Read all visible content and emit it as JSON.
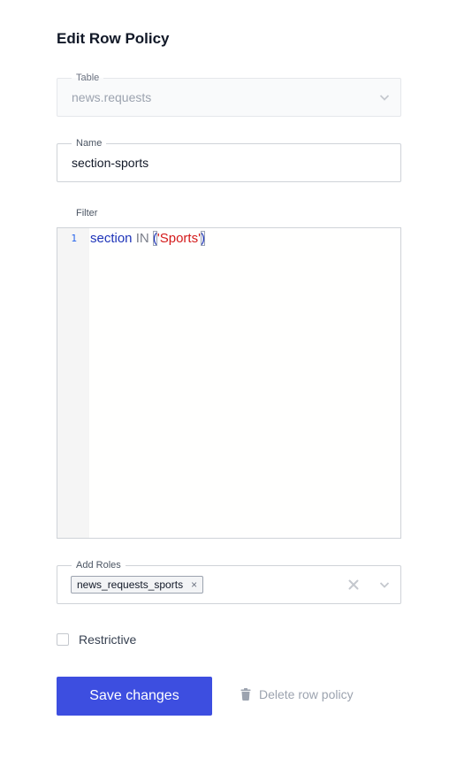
{
  "page": {
    "title": "Edit Row Policy"
  },
  "table_field": {
    "label": "Table",
    "value": "news.requests",
    "disabled": true,
    "icon": "chevron-down-icon"
  },
  "name_field": {
    "label": "Name",
    "value": "section-sports"
  },
  "filter": {
    "label": "Filter",
    "line_number": "1",
    "tokens": {
      "identifier": "section",
      "operator": "IN",
      "open_paren": "(",
      "string": "'Sports'",
      "close_paren": ")"
    }
  },
  "roles_field": {
    "label": "Add Roles",
    "selected": [
      "news_requests_sports"
    ],
    "remove_glyph": "×",
    "icons": [
      "clear-icon",
      "chevron-down-icon"
    ]
  },
  "restrictive": {
    "label": "Restrictive",
    "checked": false
  },
  "actions": {
    "save_label": "Save changes",
    "delete_label": "Delete row policy",
    "delete_icon": "trash-icon"
  },
  "colors": {
    "primary": "#3d4ee0",
    "code_identifier": "#1d33b8",
    "code_string": "#d41a1a",
    "muted_text": "#9ca3af"
  }
}
